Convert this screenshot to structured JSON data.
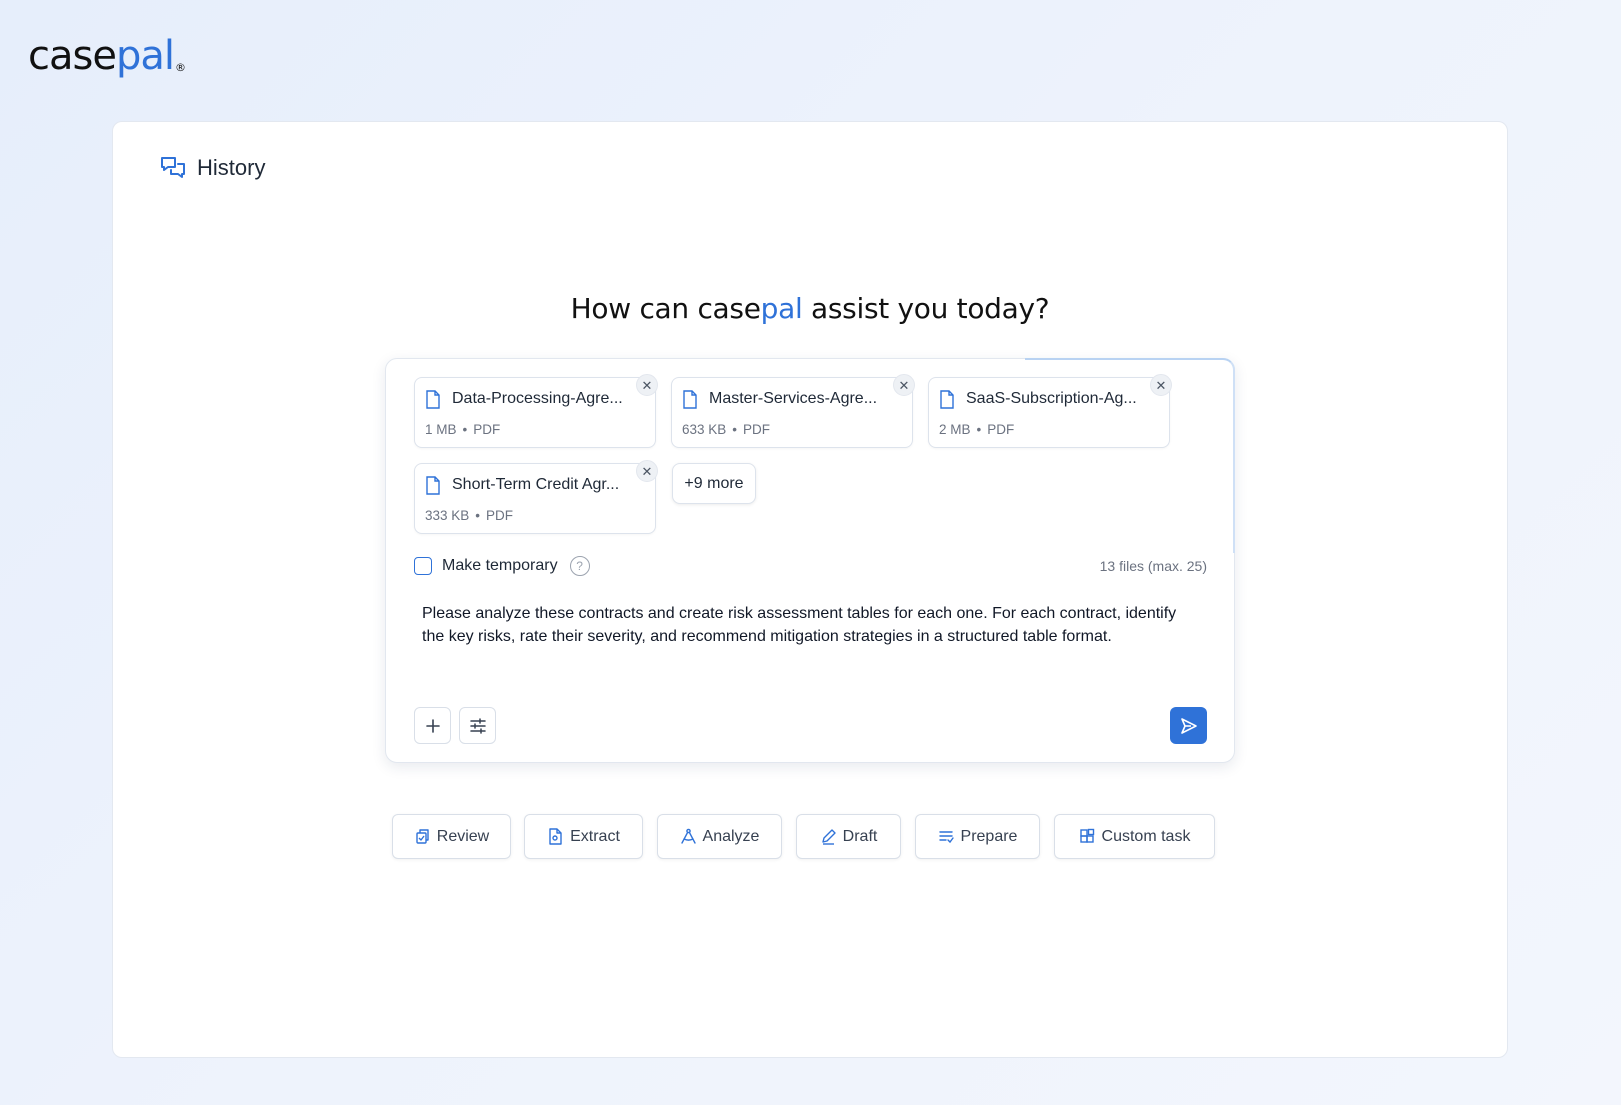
{
  "brand": {
    "logo_main": "case",
    "logo_accent": "pal",
    "logo_mark": "®",
    "accent_color": "#2f72d8"
  },
  "history": {
    "label": "History",
    "icon": "chat-bubbles-icon"
  },
  "headline": {
    "prefix": "How can ",
    "brand_main": "case",
    "brand_accent": "pal",
    "suffix": " assist you today?"
  },
  "files": [
    {
      "name": "Data-Processing-Agre...",
      "size": "1 MB",
      "type": "PDF"
    },
    {
      "name": "Master-Services-Agre...",
      "size": "633 KB",
      "type": "PDF"
    },
    {
      "name": "SaaS-Subscription-Ag...",
      "size": "2 MB",
      "type": "PDF"
    },
    {
      "name": "Short-Term Credit Agr...",
      "size": "333 KB",
      "type": "PDF"
    }
  ],
  "more_files_label": "+9 more",
  "temporary": {
    "label": "Make temporary",
    "checked": false,
    "help_icon": "question-circle-icon"
  },
  "file_count_label": "13 files (max. 25)",
  "prompt_text": "Please analyze these contracts and create risk assessment tables for each one. For each contract, identify the key risks, rate their severity, and recommend mitigation strategies in a structured table format.",
  "toolbar": {
    "add_icon": "plus-icon",
    "settings_icon": "sliders-icon",
    "send_icon": "send-icon"
  },
  "tasks": [
    {
      "label": "Review",
      "icon": "review-icon"
    },
    {
      "label": "Extract",
      "icon": "extract-icon"
    },
    {
      "label": "Analyze",
      "icon": "analyze-icon"
    },
    {
      "label": "Draft",
      "icon": "pencil-icon"
    },
    {
      "label": "Prepare",
      "icon": "list-check-icon"
    },
    {
      "label": "Custom task",
      "icon": "grid-plus-icon"
    }
  ]
}
